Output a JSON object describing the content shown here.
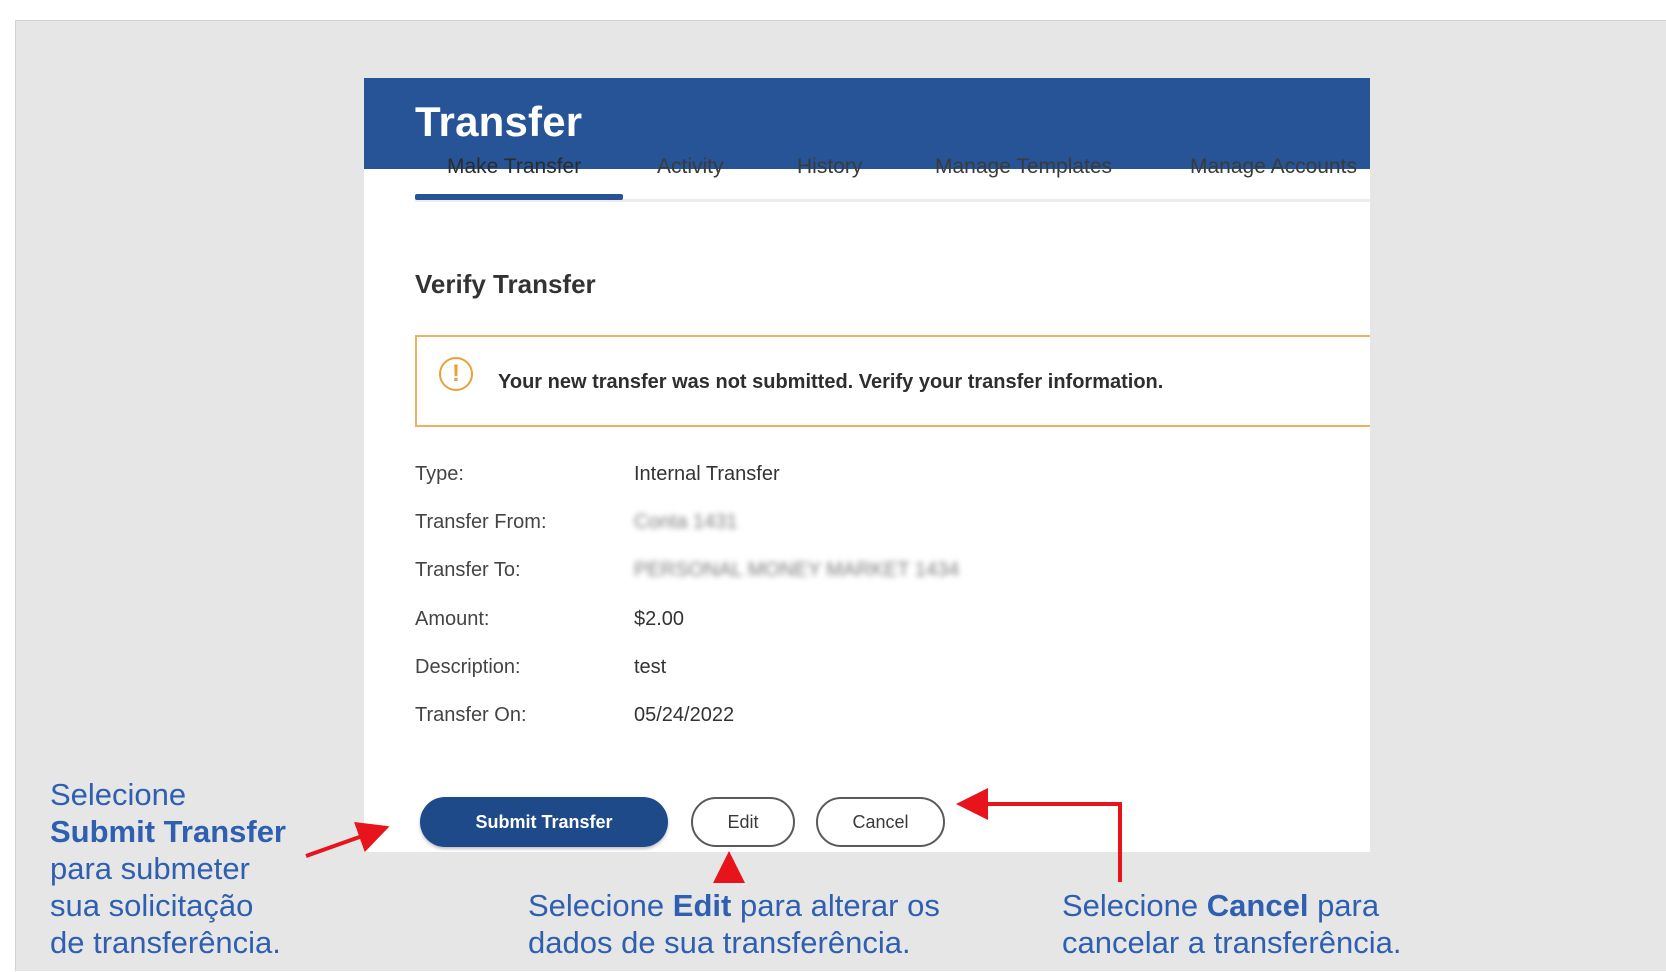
{
  "header": {
    "title": "Transfer"
  },
  "tabs": [
    {
      "label": "Make Transfer",
      "active": true
    },
    {
      "label": "Activity",
      "active": false
    },
    {
      "label": "History",
      "active": false
    },
    {
      "label": "Manage Templates",
      "active": false
    },
    {
      "label": "Manage Accounts",
      "active": false
    }
  ],
  "section_title": "Verify Transfer",
  "alert": {
    "icon": "warning-circle-icon",
    "text": "Your new transfer was not submitted. Verify your transfer information."
  },
  "details": [
    {
      "label": "Type:",
      "value": "Internal Transfer",
      "blurred": false
    },
    {
      "label": "Transfer From:",
      "value": "Conta 1431",
      "blurred": true
    },
    {
      "label": "Transfer To:",
      "value": "PERSONAL MONEY MARKET 1434",
      "blurred": true
    },
    {
      "label": "Amount:",
      "value": "$2.00",
      "blurred": false
    },
    {
      "label": "Description:",
      "value": "test",
      "blurred": false
    },
    {
      "label": "Transfer On:",
      "value": "05/24/2022",
      "blurred": false
    }
  ],
  "buttons": {
    "submit": "Submit Transfer",
    "edit": "Edit",
    "cancel": "Cancel"
  },
  "callouts": {
    "submit": {
      "line1": "Selecione",
      "bold": "Submit Transfer",
      "line3": "para submeter",
      "line4": "sua solicitação",
      "line5": "de transferência."
    },
    "edit": {
      "pre": "Selecione ",
      "bold": "Edit",
      "post": " para alterar os",
      "line2": "dados de sua transferência."
    },
    "cancel": {
      "pre": "Selecione ",
      "bold": "Cancel",
      "post": " para",
      "line2": "cancelar a transferência."
    }
  },
  "colors": {
    "brand_blue": "#265496",
    "alert_border": "#f0b05f",
    "callout_text": "#2f5fb0",
    "arrow_red": "#e8141c"
  }
}
